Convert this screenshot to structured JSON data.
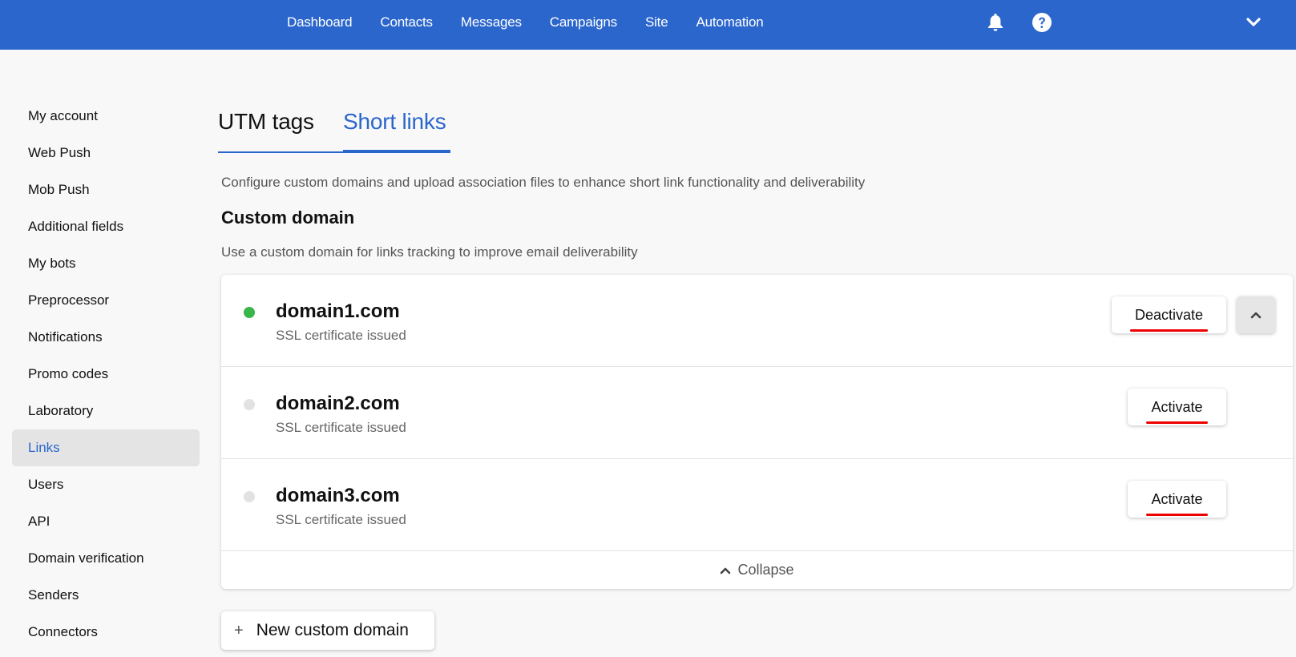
{
  "topbar": {
    "nav": [
      "Dashboard",
      "Contacts",
      "Messages",
      "Campaigns",
      "Site",
      "Automation"
    ],
    "icons": [
      "bell-icon",
      "help-icon",
      "chevron-down-icon"
    ]
  },
  "sidebar": {
    "items": [
      {
        "label": "My account"
      },
      {
        "label": "Web Push"
      },
      {
        "label": "Mob Push"
      },
      {
        "label": "Additional fields"
      },
      {
        "label": "My bots"
      },
      {
        "label": "Preprocessor"
      },
      {
        "label": "Notifications"
      },
      {
        "label": "Promo codes"
      },
      {
        "label": "Laboratory"
      },
      {
        "label": "Links",
        "active": true
      },
      {
        "label": "Users"
      },
      {
        "label": "API"
      },
      {
        "label": "Domain verification"
      },
      {
        "label": "Senders"
      },
      {
        "label": "Connectors"
      }
    ]
  },
  "main": {
    "tabs": [
      {
        "label": "UTM tags"
      },
      {
        "label": "Short links",
        "active": true
      }
    ],
    "intro": "Configure custom domains and upload association files to enhance short link functionality and deliverability",
    "section_title": "Custom domain",
    "section_desc": "Use a custom domain for links tracking to improve email deliverability",
    "domains": [
      {
        "name": "domain1.com",
        "status": "SSL certificate issued",
        "active": true,
        "action": "Deactivate",
        "dot_color": "#3ab54a"
      },
      {
        "name": "domain2.com",
        "status": "SSL certificate issued",
        "active": false,
        "action": "Activate",
        "dot_color": "#e2e2e2"
      },
      {
        "name": "domain3.com",
        "status": "SSL certificate issued",
        "active": false,
        "action": "Activate",
        "dot_color": "#e2e2e2"
      }
    ],
    "collapse_label": "Collapse",
    "new_domain_label": "New custom domain",
    "new_domain_icon": "+"
  },
  "colors": {
    "brand": "#2b66cc",
    "active_dot": "#3ab54a",
    "inactive_dot": "#e2e2e2",
    "annotation_underline": "#e00000"
  }
}
